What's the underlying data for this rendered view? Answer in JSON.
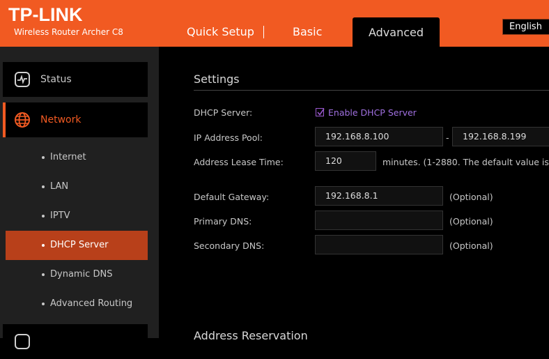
{
  "header": {
    "logo": "TP-LINK",
    "model": "Wireless Router Archer C8",
    "tabs": [
      {
        "label": "Quick Setup"
      },
      {
        "label": "Basic"
      },
      {
        "label": "Advanced"
      }
    ],
    "language": "English",
    "accent": "#f15a22"
  },
  "sidebar": {
    "status": {
      "label": "Status",
      "icon": "activity-icon"
    },
    "network": {
      "label": "Network",
      "icon": "globe-icon"
    },
    "sub_items": [
      {
        "label": "Internet"
      },
      {
        "label": "LAN"
      },
      {
        "label": "IPTV"
      },
      {
        "label": "DHCP Server"
      },
      {
        "label": "Dynamic DNS"
      },
      {
        "label": "Advanced Routing"
      }
    ]
  },
  "settings": {
    "title": "Settings",
    "dhcp_server_label": "DHCP Server:",
    "enable_dhcp_label": "Enable DHCP Server",
    "enable_dhcp_checked": true,
    "ip_pool_label": "IP Address Pool:",
    "ip_pool_start": "192.168.8.100",
    "ip_pool_dash": "-",
    "ip_pool_end": "192.168.8.199",
    "lease_time_label": "Address Lease Time:",
    "lease_time_value": "120",
    "lease_time_note": "minutes. (1-2880. The default value is",
    "gateway_label": "Default Gateway:",
    "gateway_value": "192.168.8.1",
    "primary_dns_label": "Primary DNS:",
    "primary_dns_value": "",
    "secondary_dns_label": "Secondary DNS:",
    "secondary_dns_value": "",
    "optional": "(Optional)"
  },
  "address_reservation": {
    "title": "Address Reservation"
  }
}
